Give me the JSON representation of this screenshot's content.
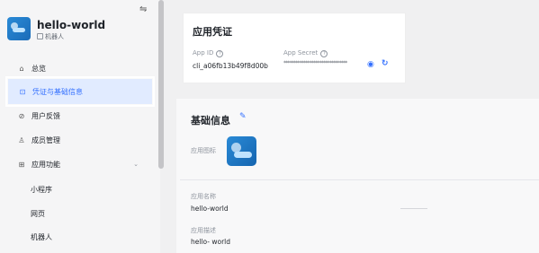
{
  "sidebar": {
    "collapse_icon": "⇋",
    "app": {
      "name": "hello-world",
      "type": "机器人"
    },
    "items": [
      {
        "label": "总览",
        "icon": "⌂"
      },
      {
        "label": "凭证与基础信息",
        "icon": "⊡"
      },
      {
        "label": "用户反馈",
        "icon": "⊘"
      },
      {
        "label": "成员管理",
        "icon": "♙"
      },
      {
        "label": "应用功能",
        "icon": "⊞",
        "chevron": "⌄"
      }
    ],
    "subitems": [
      "小程序",
      "网页",
      "机器人"
    ]
  },
  "credentials": {
    "title": "应用凭证",
    "app_id_label": "App ID",
    "app_id": "cli_a06fb13b49f8d00b",
    "app_secret_label": "App Secret",
    "app_secret": "********************************",
    "help_icon": "?",
    "eye_icon": "◉",
    "refresh_icon": "↻"
  },
  "basic": {
    "title": "基础信息",
    "edit_icon": "✎",
    "icon_label": "应用图标",
    "name_label": "应用名称",
    "name": "hello-world",
    "desc_label": "应用描述",
    "desc": "hello- world"
  },
  "colors": {
    "accent": "#3370ff",
    "active_bg": "#e1ebff"
  }
}
